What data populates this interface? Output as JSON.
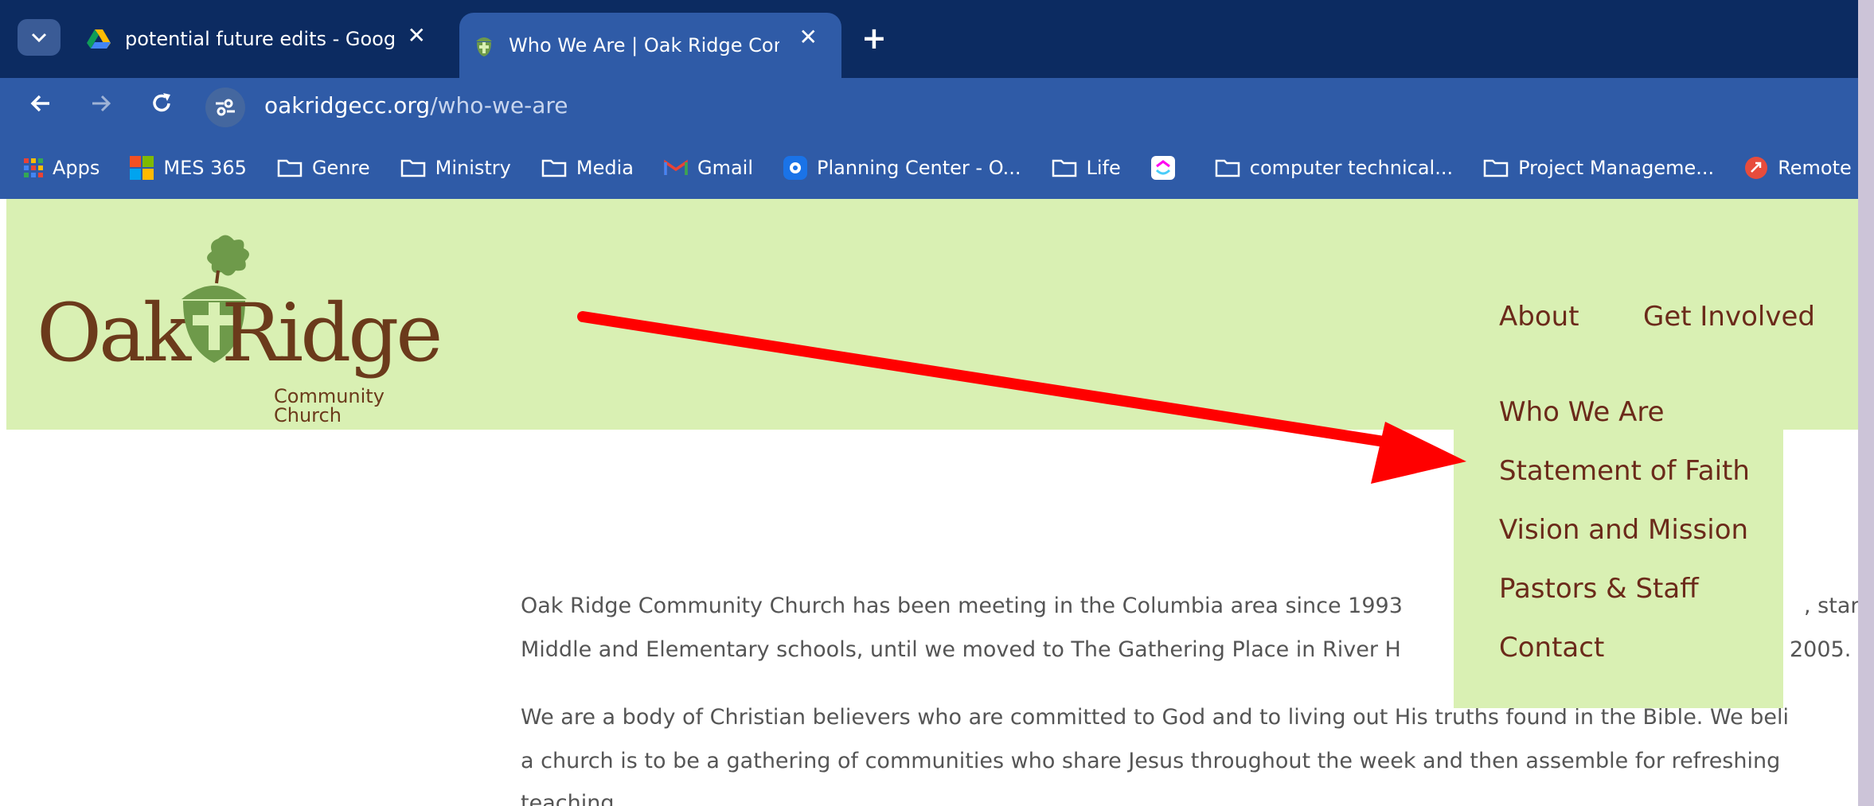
{
  "browser": {
    "tabs": [
      {
        "title": "potential future edits - Google D",
        "active": false
      },
      {
        "title": "Who We Are | Oak Ridge Comm",
        "active": true
      }
    ],
    "close_glyph": "✕",
    "new_tab_glyph": "+",
    "url_host": "oakridgecc.org",
    "url_path": "/who-we-are",
    "bookmarks": [
      {
        "label": "Apps",
        "icon": "apps-grid-icon"
      },
      {
        "label": "MES 365",
        "icon": "microsoft-icon"
      },
      {
        "label": "Genre",
        "icon": "folder-icon"
      },
      {
        "label": "Ministry",
        "icon": "folder-icon"
      },
      {
        "label": "Media",
        "icon": "folder-icon"
      },
      {
        "label": "Gmail",
        "icon": "gmail-icon"
      },
      {
        "label": "Planning Center - O...",
        "icon": "planning-center-icon"
      },
      {
        "label": "Life",
        "icon": "folder-icon"
      },
      {
        "label": "",
        "icon": "clickup-icon"
      },
      {
        "label": "computer technical...",
        "icon": "folder-icon"
      },
      {
        "label": "Project Manageme...",
        "icon": "folder-icon"
      },
      {
        "label": "Remote D",
        "icon": "remote-desktop-icon"
      }
    ]
  },
  "site": {
    "logo": {
      "oak": "Oak",
      "ridge": "Ridge",
      "community": "Community",
      "church": "Church"
    },
    "nav": {
      "about": "About",
      "get_involved": "Get Involved"
    },
    "dropdown": [
      "Who We Are",
      "Statement of Faith",
      "Vision and Mission",
      "Pastors & Staff",
      "Contact"
    ],
    "paragraphs": [
      "Oak Ridge Community Church has been meeting in the Columbia area since 1993",
      ", starti",
      "Middle and Elementary schools, until we moved to The Gathering Place in River H",
      "2005.",
      "We are a body of Christian believers who are committed to God and to living out His truths found in the Bible. We beli",
      "a church is to be a gathering of communities who share Jesus throughout the week and then assemble for refreshing",
      "teaching."
    ]
  },
  "colors": {
    "tab_strip": "#0c2b61",
    "toolbar": "#2f5ba7",
    "header_green": "#d9f0b3",
    "logo_brown": "#6b3a1b",
    "logo_green": "#6e9a4a",
    "nav_text": "#6b2a1a",
    "arrow_red": "#ff0000"
  }
}
